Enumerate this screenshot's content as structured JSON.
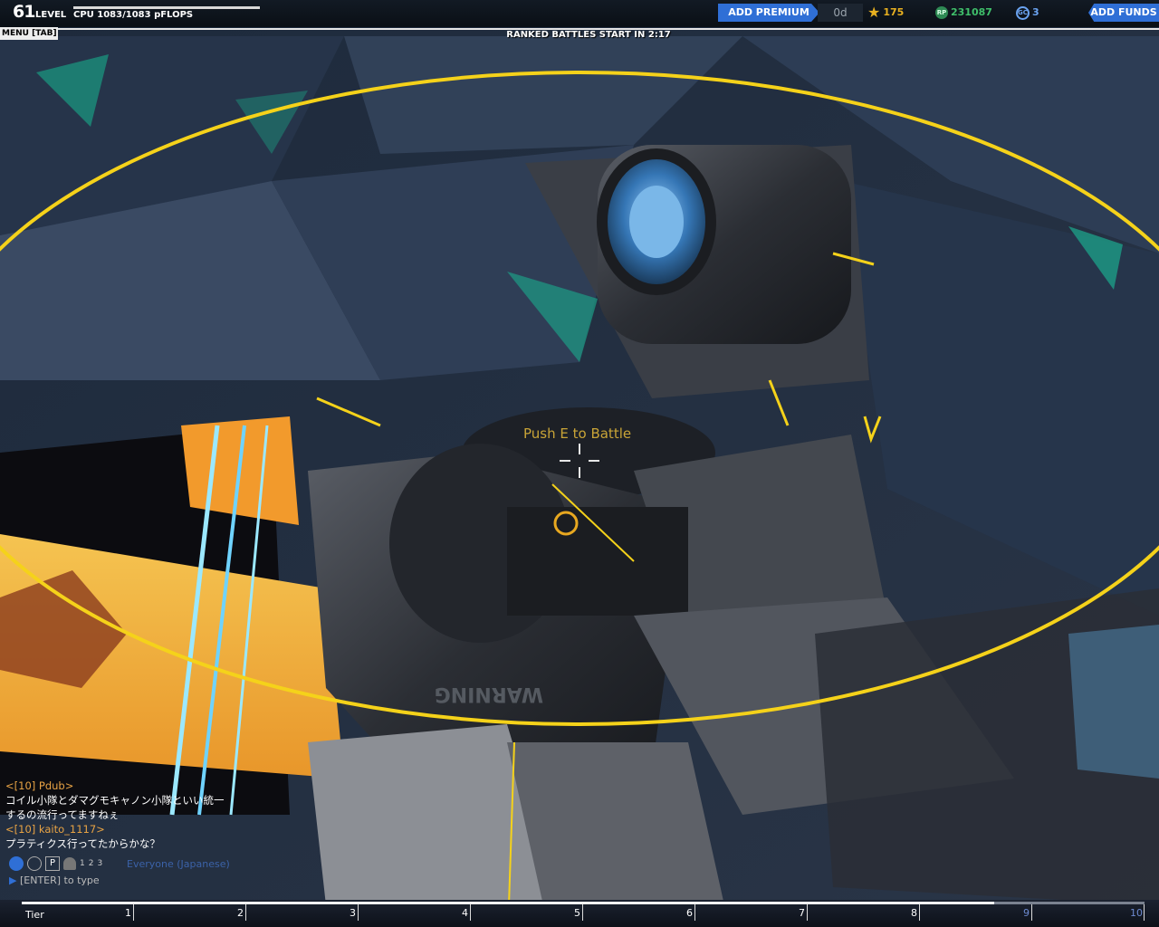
{
  "header": {
    "level": "61",
    "level_label": "LEVEL",
    "cpu": "CPU 1083/1083 pFLOPS",
    "menu": "MENU [TAB]",
    "ranked": "RANKED BATTLES START IN  2:17",
    "add_premium": "ADD PREMIUM",
    "premium_days": "0d",
    "stars": "175",
    "rp": "231087",
    "gc": "3",
    "add_funds": "ADD FUNDS",
    "rp_icon_text": "RP",
    "gc_icon_text": "GC"
  },
  "hud": {
    "prompt": "Push E to Battle"
  },
  "chat": {
    "messages": [
      {
        "name": "<[10] Pdub>",
        "text": "コイル小隊とダマグモキャノン小隊といい統一"
      },
      {
        "name": "",
        "text": "するの流行ってますねぇ"
      },
      {
        "name": "<[10] kaito_1117>",
        "text": "プラティクス行ってたからかな？"
      }
    ],
    "channel": "Everyone (Japanese)",
    "input_placeholder": "[ENTER] to type",
    "icon_letters": [
      "P",
      "1",
      "2",
      "3"
    ]
  },
  "scene_text": {
    "warning": "WARNING"
  },
  "tier": {
    "label": "Tier",
    "ticks": [
      "1",
      "2",
      "3",
      "4",
      "5",
      "6",
      "7",
      "8",
      "9",
      "10"
    ],
    "progress": 0.866
  },
  "colors": {
    "accent_blue": "#2f6fd6",
    "hud_yellow": "#f5d21a",
    "star_gold": "#e8b020",
    "rp_green": "#3fbf6a",
    "chat_name": "#e8a344"
  }
}
